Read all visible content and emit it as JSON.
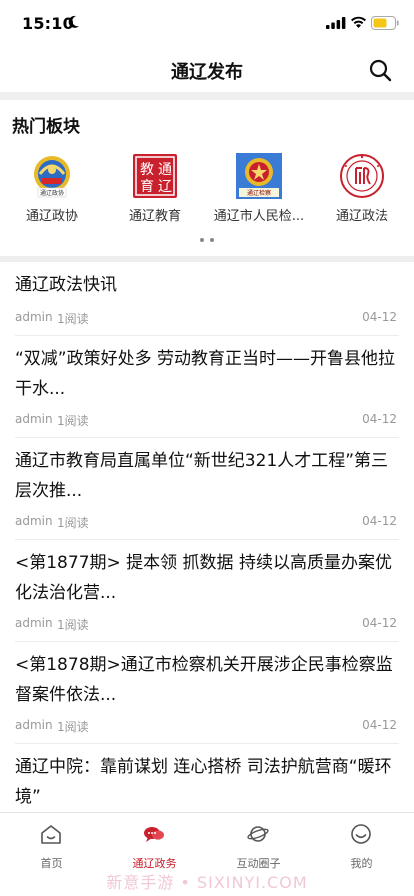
{
  "status_bar": {
    "time": "15:10"
  },
  "header": {
    "title": "通辽发布",
    "search_icon": "search-icon"
  },
  "hot_section": {
    "title": "热门板块",
    "items": [
      {
        "label": "通辽政协",
        "icon": "cppcc-emblem-logo",
        "logo_text": "通辽政协"
      },
      {
        "label": "通辽教育",
        "icon": "education-seal-logo",
        "logo_text": [
          "教",
          "通",
          "育",
          "辽"
        ]
      },
      {
        "label": "通辽市人民检...",
        "icon": "procuratorate-emblem-logo",
        "logo_text": "通辽检察"
      },
      {
        "label": "通辽政法",
        "icon": "political-legal-logo"
      }
    ],
    "pagination": {
      "pages": 2,
      "current": 1
    }
  },
  "news": [
    {
      "title": "通辽政法快讯",
      "author": "admin",
      "reads": "1阅读",
      "date": "04-12"
    },
    {
      "title": "“双减”政策好处多 劳动教育正当时——开鲁县他拉干水...",
      "author": "admin",
      "reads": "1阅读",
      "date": "04-12"
    },
    {
      "title": "通辽市教育局直属单位“新世纪321人才工程”第三层次推...",
      "author": "admin",
      "reads": "1阅读",
      "date": "04-12"
    },
    {
      "title": "<第1877期> 提本领 抓数据 持续以高质量办案优化法治化营...",
      "author": "admin",
      "reads": "1阅读",
      "date": "04-12"
    },
    {
      "title": "<第1878期>通辽市检察机关开展涉企民事检察监督案件依法...",
      "author": "admin",
      "reads": "1阅读",
      "date": "04-12"
    },
    {
      "title": "通辽中院：靠前谋划 连心搭桥 司法护航营商“暖环境”",
      "author": "",
      "reads": "",
      "date": ""
    }
  ],
  "tab_bar": {
    "tabs": [
      {
        "label": "首页",
        "icon": "home-icon",
        "active": false
      },
      {
        "label": "通辽政务",
        "icon": "chat-bubbles-icon",
        "active": true
      },
      {
        "label": "互动圈子",
        "icon": "planet-icon",
        "active": false
      },
      {
        "label": "我的",
        "icon": "smile-icon",
        "active": false
      }
    ]
  },
  "watermark": "新意手游 • SIXINYI.COM",
  "colors": {
    "accent": "#c8202c",
    "divider": "#eeeeee",
    "meta": "#999999"
  }
}
